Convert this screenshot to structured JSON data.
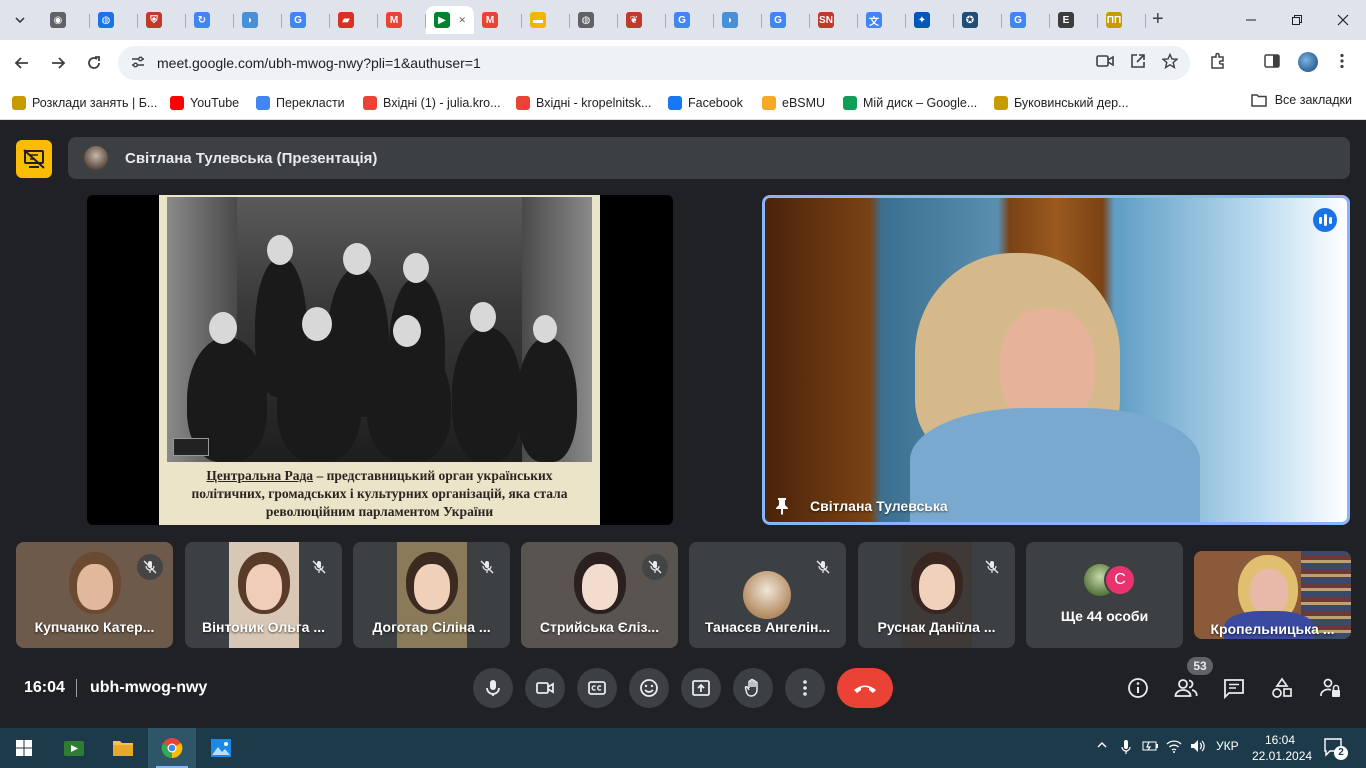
{
  "browser": {
    "tabs": [
      {
        "name": "tab-chrome",
        "icon": "chrome-icon",
        "color": "#5f6368",
        "glyph": "◉"
      },
      {
        "name": "tab-globe",
        "icon": "globe-icon",
        "color": "#1a73e8",
        "glyph": "◍"
      },
      {
        "name": "tab-university",
        "icon": "crest-icon",
        "color": "#c0392b",
        "glyph": "⛨"
      },
      {
        "name": "tab-translate",
        "icon": "sync-icon",
        "color": "#4285f4",
        "glyph": "↻"
      },
      {
        "name": "tab-pill-1",
        "icon": "pill-icon",
        "color": "#4a90d9",
        "glyph": "◗"
      },
      {
        "name": "tab-google-1",
        "icon": "google-icon",
        "color": "#4285f4",
        "glyph": "G"
      },
      {
        "name": "tab-red-book",
        "icon": "book-icon",
        "color": "#d93025",
        "glyph": "▰"
      },
      {
        "name": "tab-gmail-1",
        "icon": "gmail-icon",
        "color": "#ea4335",
        "glyph": "M"
      },
      {
        "name": "tab-meet-active",
        "icon": "meet-icon",
        "color": "#00832d",
        "glyph": "▶"
      },
      {
        "name": "tab-gmail-2",
        "icon": "gmail-icon",
        "color": "#ea4335",
        "glyph": "M"
      },
      {
        "name": "tab-folder",
        "icon": "folder-icon",
        "color": "#f4b400",
        "glyph": "▬"
      },
      {
        "name": "tab-globe-2",
        "icon": "globe-icon",
        "color": "#5f6368",
        "glyph": "◍"
      },
      {
        "name": "tab-cherry",
        "icon": "cherry-icon",
        "color": "#c0392b",
        "glyph": "❦"
      },
      {
        "name": "tab-google-2",
        "icon": "google-icon",
        "color": "#4285f4",
        "glyph": "G"
      },
      {
        "name": "tab-pill-2",
        "icon": "pill-icon",
        "color": "#4a90d9",
        "glyph": "◗"
      },
      {
        "name": "tab-google-3",
        "icon": "google-icon",
        "color": "#4285f4",
        "glyph": "G"
      },
      {
        "name": "tab-sn",
        "icon": "sn-icon",
        "color": "#c0392b",
        "glyph": "SN"
      },
      {
        "name": "tab-translate-2",
        "icon": "translate-icon",
        "color": "#4285f4",
        "glyph": "文"
      },
      {
        "name": "tab-emblem",
        "icon": "emblem-icon",
        "color": "#0057b7",
        "glyph": "✦"
      },
      {
        "name": "tab-owl",
        "icon": "owl-icon",
        "color": "#1f4e79",
        "glyph": "✪"
      },
      {
        "name": "tab-google-4",
        "icon": "google-icon",
        "color": "#4285f4",
        "glyph": "G"
      },
      {
        "name": "tab-e",
        "icon": "e-letter-icon",
        "color": "#3c3c3c",
        "glyph": "E"
      },
      {
        "name": "tab-bukovyna",
        "icon": "flag-icon",
        "color": "#c79a00",
        "glyph": "ΠΠ"
      }
    ],
    "url": "meet.google.com/ubh-mwog-nwy?pli=1&authuser=1"
  },
  "bookmarks": [
    {
      "label": "Розклади занять | Б...",
      "icon": "crest-icon",
      "color": "#c79a00"
    },
    {
      "label": "YouTube",
      "icon": "youtube-icon",
      "color": "#ff0000"
    },
    {
      "label": "Перекласти",
      "icon": "translate-icon",
      "color": "#4285f4"
    },
    {
      "label": "Вхідні (1) - julia.kro...",
      "icon": "gmail-icon",
      "color": "#ea4335"
    },
    {
      "label": "Вхідні - kropelnitsk...",
      "icon": "gmail-icon",
      "color": "#ea4335"
    },
    {
      "label": "Facebook",
      "icon": "facebook-icon",
      "color": "#1877f2"
    },
    {
      "label": "eBSMU",
      "icon": "ebsmu-icon",
      "color": "#f9a825"
    },
    {
      "label": "Мій диск – Google...",
      "icon": "drive-icon",
      "color": "#0f9d58"
    },
    {
      "label": "Буковинський дер...",
      "icon": "university-icon",
      "color": "#c79a00"
    }
  ],
  "bookmarks_all": "Все закладки",
  "meet": {
    "presenter_title": "Світлана Тулевська (Презентація)",
    "slide": {
      "caption_link": "Центральна Рада",
      "caption_rest": " – представницький орган українських політичних, громадських і культурних організацій, яка стала революційним парламентом України"
    },
    "pinned_name": "Світлана Тулевська",
    "participants": [
      {
        "name": "Купчанко Катер...",
        "bg": "#6d5a4a"
      },
      {
        "name": "Вінтоник Ольга ...",
        "bg": "#d8c7b4"
      },
      {
        "name": "Доготар Сіліна ...",
        "bg": "#8a7a5a"
      },
      {
        "name": "Стрийська Єліз...",
        "bg": "#5a5450"
      },
      {
        "name": "Танасєв Ангелін...",
        "bg": ""
      },
      {
        "name": "Руснак Даніїла ...",
        "bg": "#3e3a38"
      }
    ],
    "more": {
      "label": "Ще 44 особи",
      "letter": "С"
    },
    "last_tile_name": "Кропельницька ...",
    "clock": "16:04",
    "meeting_code": "ubh-mwog-nwy",
    "people_count": "53"
  },
  "taskbar": {
    "lang": "УКР",
    "time": "16:04",
    "date": "22.01.2024",
    "notifications": "2"
  }
}
